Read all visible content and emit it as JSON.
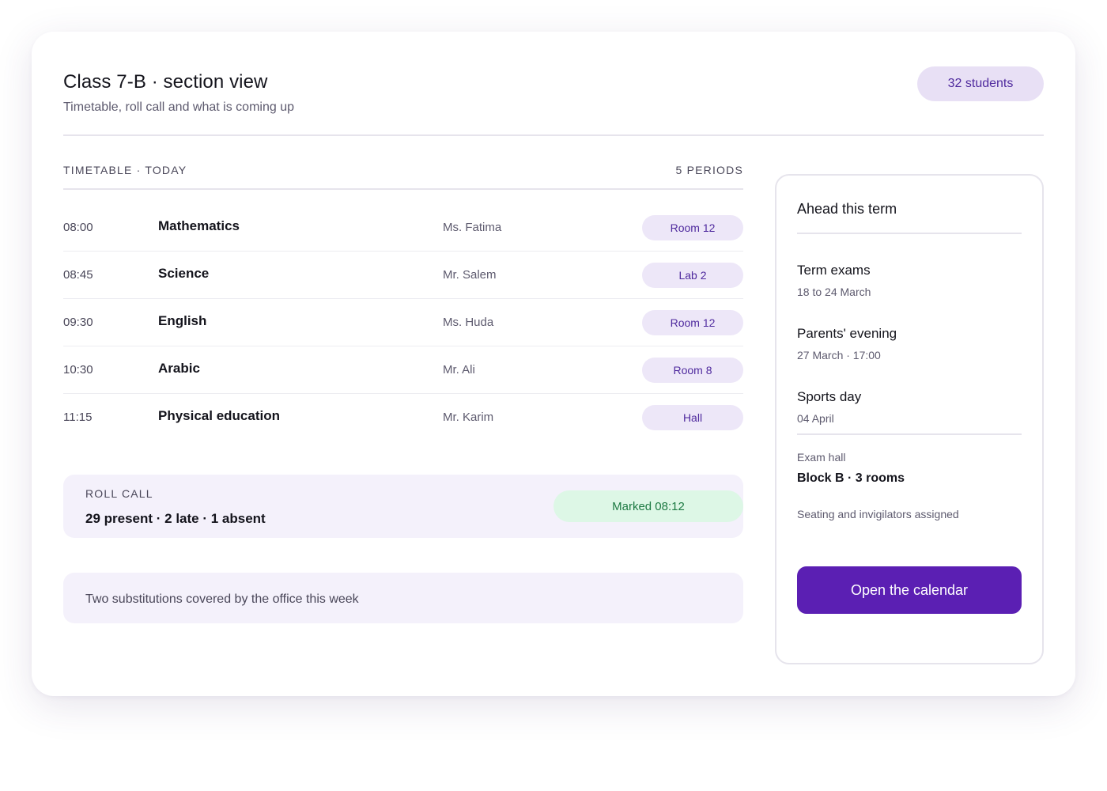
{
  "header": {
    "title": "Class 7-B · section view",
    "subtitle": "Timetable, roll call and what is coming up",
    "students_badge": "32 students"
  },
  "timetable": {
    "heading": "TIMETABLE · TODAY",
    "count": "5 PERIODS",
    "periods": [
      {
        "time": "08:00",
        "subject": "Mathematics",
        "teacher": "Ms. Fatima",
        "room": "Room 12"
      },
      {
        "time": "08:45",
        "subject": "Science",
        "teacher": "Mr. Salem",
        "room": "Lab 2"
      },
      {
        "time": "09:30",
        "subject": "English",
        "teacher": "Ms. Huda",
        "room": "Room 12"
      },
      {
        "time": "10:30",
        "subject": "Arabic",
        "teacher": "Mr. Ali",
        "room": "Room 8"
      },
      {
        "time": "11:15",
        "subject": "Physical education",
        "teacher": "Mr. Karim",
        "room": "Hall"
      }
    ]
  },
  "roll_call": {
    "label": "ROLL CALL",
    "summary": "29 present · 2 late · 1 absent",
    "status": "Marked 08:12"
  },
  "note": {
    "text": "Two substitutions covered by the office this week"
  },
  "side": {
    "title": "Ahead this term",
    "events": [
      {
        "name": "Term exams",
        "date": "18 to 24 March"
      },
      {
        "name": "Parents' evening",
        "date": "27 March · 17:00"
      },
      {
        "name": "Sports day",
        "date": "04 April"
      }
    ],
    "hall_label": "Exam hall",
    "hall_value": "Block B · 3 rooms",
    "hall_note": "Seating and invigilators assigned",
    "button_label": "Open the calendar"
  },
  "colors": {
    "accent": "#5b1fb3",
    "pill_bg": "#ede7f8",
    "success_bg": "#ddf7e6",
    "success_text": "#1d7a43"
  }
}
